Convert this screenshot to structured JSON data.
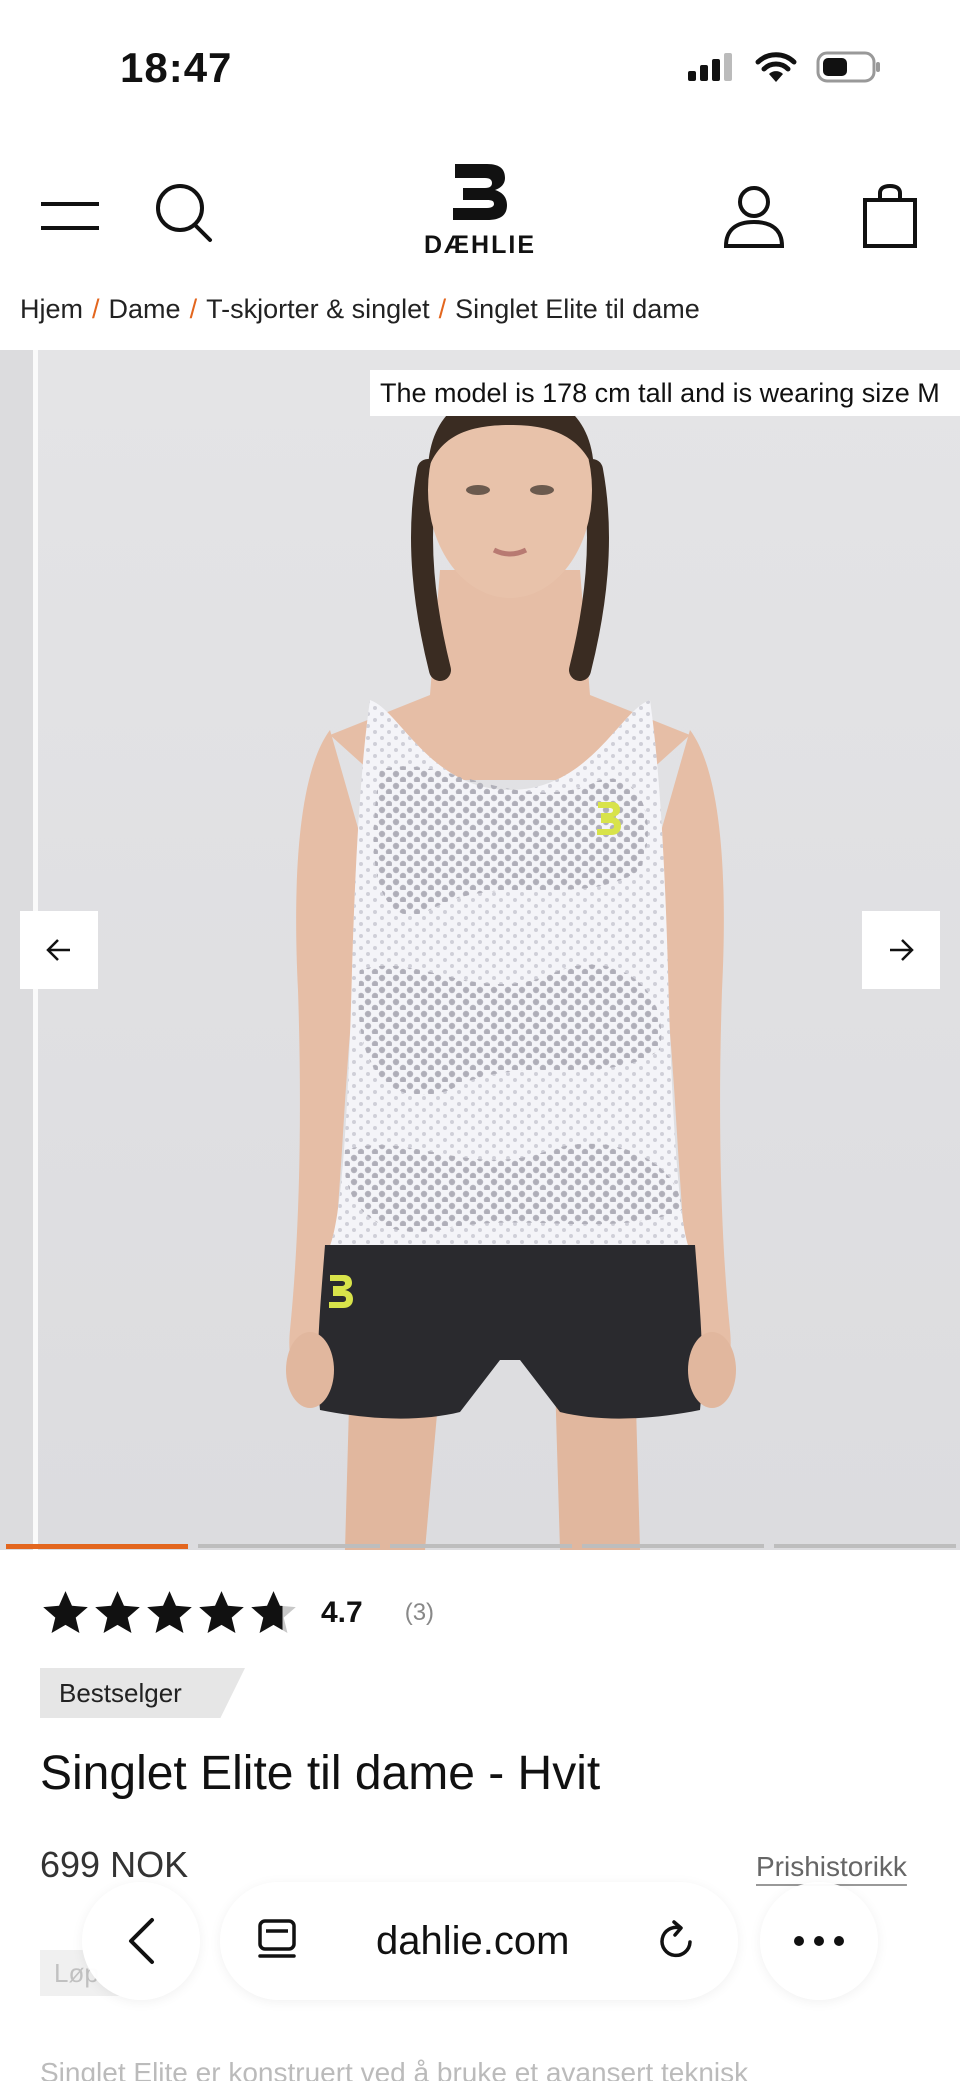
{
  "status_bar": {
    "time": "18:47"
  },
  "header": {
    "logo_text": "DÆHLIE"
  },
  "breadcrumb": {
    "items": [
      "Hjem",
      "Dame",
      "T-skjorter & singlet",
      "Singlet Elite til dame"
    ],
    "separator": "/"
  },
  "gallery": {
    "caption": "The model is 178 cm tall and is wearing size M",
    "slides_total": 5,
    "active_slide": 1
  },
  "product": {
    "rating_value": "4.7",
    "rating_count": "(3)",
    "rating_stars": 4.7,
    "badge": "Bestselger",
    "title": "Singlet Elite til dame - Hvit",
    "price": "699 NOK",
    "price_history_link": "Prishistorikk",
    "category_chip": "Løp",
    "description_start": "Singlet Elite er konstruert ved å bruke et avansert teknisk"
  },
  "safari": {
    "url": "dahlie.com"
  },
  "colors": {
    "accent": "#e3661e",
    "logo_yellow": "#d8e34a"
  }
}
